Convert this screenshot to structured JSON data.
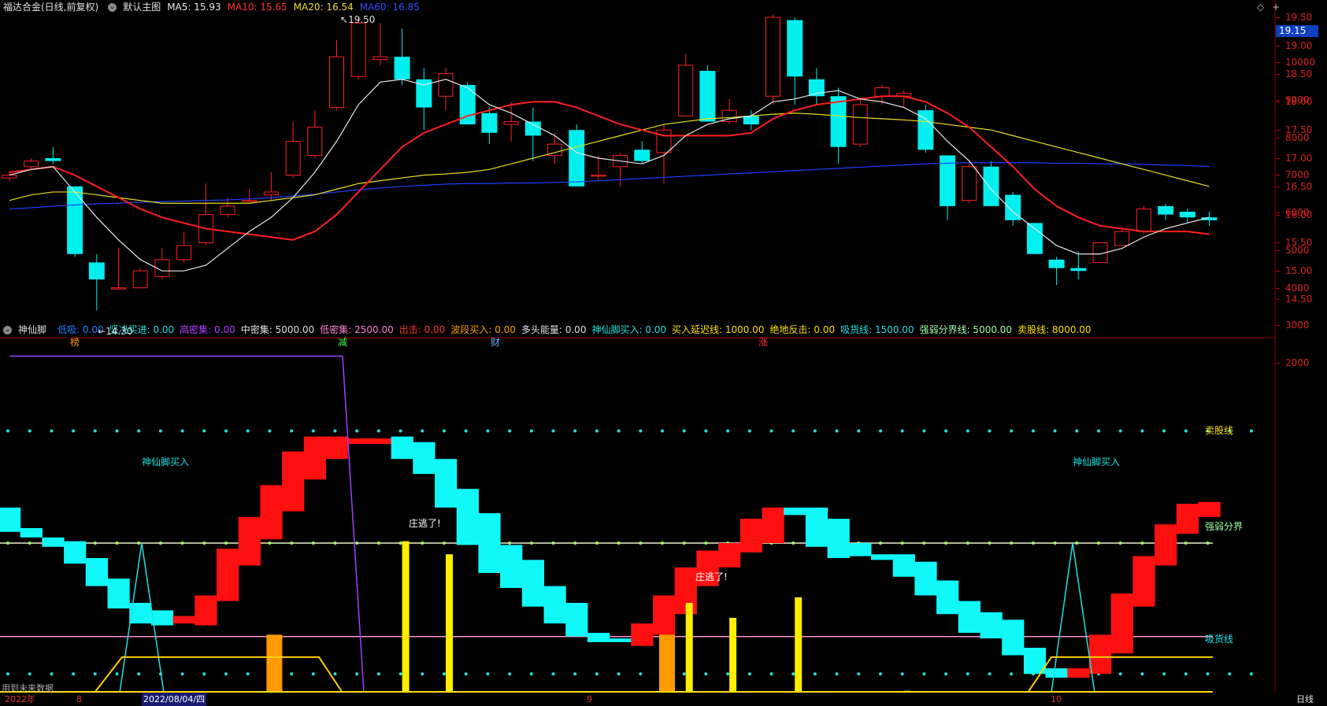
{
  "colors": {
    "up": "#ff2020",
    "down": "#00f0f0",
    "ma5": "#e8e8e8",
    "ma10": "#ff2020",
    "ma20": "#e8e020",
    "ma60": "#2040ff",
    "yellow": "#ffee00",
    "orange": "#ff9900",
    "purple": "#a040ff",
    "pink": "#ff90d0",
    "grid": "#8a0000"
  },
  "header": {
    "title": "福达合金(日线,前复权)",
    "main_chart": "默认主图",
    "ma": [
      {
        "label": "MA5: 15.93",
        "color": "#e8e8e8"
      },
      {
        "label": "MA10: 15.65",
        "color": "#ff3030"
      },
      {
        "label": "MA20: 16.54",
        "color": "#e8e020"
      },
      {
        "label": "MA60: 16.85",
        "color": "#3050ff"
      }
    ]
  },
  "indicator_header": {
    "name": "神仙脚",
    "values": [
      {
        "label": "低吸: 0.00",
        "color": "#2080ff"
      },
      {
        "label": "坚决买进: 0.00",
        "color": "#20e0e0"
      },
      {
        "label": "高密集: 0.00",
        "color": "#b040ff"
      },
      {
        "label": "中密集: 5000.00",
        "color": "#e0e0e0"
      },
      {
        "label": "低密集: 2500.00",
        "color": "#ff80d0"
      },
      {
        "label": "出击: 0.00",
        "color": "#ff3030"
      },
      {
        "label": "波段买入: 0.00",
        "color": "#ffa000"
      },
      {
        "label": "多头能量: 0.00",
        "color": "#e0e0e0"
      },
      {
        "label": "神仙脚买入: 0.00",
        "color": "#20e0e0"
      },
      {
        "label": "买入延迟线: 1000.00",
        "color": "#ffe000"
      },
      {
        "label": "绝地反击: 0.00",
        "color": "#ffe000"
      },
      {
        "label": "吸货线: 1500.00",
        "color": "#20e0e0"
      },
      {
        "label": "强弱分界线: 5000.00",
        "color": "#a0ffa0"
      },
      {
        "label": "卖股线: 8000.00",
        "color": "#ffe000"
      }
    ]
  },
  "price_axis": {
    "ticks": [
      "19.50",
      "19.00",
      "18.50",
      "18.00",
      "17.50",
      "17.00",
      "16.50",
      "16.00",
      "15.50",
      "15.00",
      "14.50"
    ],
    "current": "19.15"
  },
  "indicator_axis": {
    "ticks": [
      "10000",
      "9000",
      "8000",
      "7000",
      "6000",
      "5000",
      "4000",
      "3000",
      "2000"
    ]
  },
  "date_axis": {
    "labels": [
      "2022年",
      "8",
      "2022/08/04/四",
      "9",
      "10"
    ],
    "period": "日线"
  },
  "annotations": {
    "high": "19.50",
    "low": "14.30",
    "flags": [
      "榜",
      "减",
      "财",
      "涨"
    ]
  },
  "indicator_labels": {
    "buy1": "神仙脚买入",
    "buy2": "神仙脚买入",
    "escape1": "庄逃了!",
    "escape2": "庄逃了!",
    "sell_line": "卖股线",
    "divide_line": "强弱分界",
    "absorb_line": "吸货线",
    "footer": "用到未来数据"
  },
  "candles": [
    [
      16.65,
      16.7,
      16.6,
      16.75
    ],
    [
      16.85,
      16.95,
      16.8,
      17.0
    ],
    [
      17.0,
      16.95,
      16.9,
      17.2
    ],
    [
      16.5,
      15.3,
      15.25,
      16.5
    ],
    [
      15.15,
      14.85,
      14.3,
      15.3
    ],
    [
      14.7,
      14.7,
      14.7,
      15.4
    ],
    [
      14.7,
      15.0,
      14.7,
      15.05
    ],
    [
      14.9,
      15.2,
      14.85,
      15.4
    ],
    [
      15.2,
      15.45,
      15.15,
      15.7
    ],
    [
      15.5,
      16.0,
      15.45,
      16.55
    ],
    [
      16.0,
      16.15,
      15.95,
      16.3
    ],
    [
      16.25,
      16.25,
      16.25,
      16.45
    ],
    [
      16.35,
      16.4,
      16.25,
      16.75
    ],
    [
      16.7,
      17.3,
      16.65,
      17.65
    ],
    [
      17.05,
      17.55,
      17.0,
      17.85
    ],
    [
      17.9,
      18.8,
      17.85,
      19.1
    ],
    [
      18.45,
      19.4,
      18.4,
      19.5
    ],
    [
      18.75,
      18.8,
      18.65,
      19.4
    ],
    [
      18.8,
      18.4,
      18.3,
      19.3
    ],
    [
      18.4,
      17.9,
      17.5,
      18.6
    ],
    [
      18.1,
      18.5,
      17.85,
      18.6
    ],
    [
      18.3,
      17.6,
      17.6,
      18.35
    ],
    [
      17.8,
      17.45,
      17.25,
      17.9
    ],
    [
      17.6,
      17.65,
      17.3,
      18.0
    ],
    [
      17.65,
      17.4,
      16.95,
      17.9
    ],
    [
      17.05,
      17.25,
      16.9,
      17.45
    ],
    [
      17.5,
      16.5,
      16.5,
      17.6
    ],
    [
      16.7,
      16.7,
      16.6,
      17.05
    ],
    [
      16.85,
      17.05,
      16.5,
      17.1
    ],
    [
      17.15,
      16.95,
      16.9,
      17.3
    ],
    [
      17.1,
      17.5,
      16.55,
      17.6
    ],
    [
      17.75,
      18.65,
      17.75,
      18.85
    ],
    [
      18.55,
      17.65,
      17.65,
      18.65
    ],
    [
      17.65,
      17.85,
      17.6,
      18.05
    ],
    [
      17.75,
      17.6,
      17.5,
      17.85
    ],
    [
      18.1,
      19.5,
      17.95,
      19.55
    ],
    [
      19.45,
      18.45,
      17.95,
      19.5
    ],
    [
      18.4,
      18.1,
      17.95,
      18.6
    ],
    [
      18.1,
      17.2,
      16.9,
      18.25
    ],
    [
      17.25,
      17.95,
      17.2,
      18.05
    ],
    [
      18.1,
      18.25,
      17.95,
      18.3
    ],
    [
      18.1,
      18.15,
      17.9,
      18.2
    ],
    [
      17.85,
      17.15,
      17.1,
      17.95
    ],
    [
      17.05,
      16.15,
      15.9,
      17.05
    ],
    [
      16.25,
      16.85,
      16.2,
      16.95
    ],
    [
      16.85,
      16.15,
      16.15,
      16.95
    ],
    [
      16.35,
      15.9,
      15.8,
      16.4
    ],
    [
      15.85,
      15.3,
      15.3,
      15.85
    ],
    [
      15.2,
      15.05,
      14.75,
      15.25
    ],
    [
      15.05,
      15.0,
      14.85,
      15.35
    ],
    [
      15.15,
      15.5,
      15.15,
      15.5
    ],
    [
      15.45,
      15.7,
      15.45,
      15.75
    ],
    [
      15.7,
      16.1,
      15.65,
      16.15
    ],
    [
      16.15,
      16.0,
      15.9,
      16.2
    ],
    [
      16.05,
      15.95,
      15.85,
      16.1
    ],
    [
      15.95,
      15.9,
      15.8,
      16.05
    ]
  ],
  "ma5": [
    16.7,
    16.8,
    16.85,
    16.4,
    15.95,
    15.55,
    15.2,
    15.0,
    15.0,
    15.1,
    15.4,
    15.7,
    15.95,
    16.3,
    16.75,
    17.3,
    17.95,
    18.35,
    18.4,
    18.3,
    18.4,
    18.25,
    17.95,
    17.8,
    17.6,
    17.4,
    17.1,
    17.0,
    16.95,
    16.9,
    17.05,
    17.4,
    17.6,
    17.7,
    17.75,
    18.0,
    18.05,
    18.15,
    18.2,
    18.05,
    18.0,
    17.9,
    17.7,
    17.3,
    16.95,
    16.45,
    16.05,
    15.75,
    15.45,
    15.3,
    15.3,
    15.4,
    15.6,
    15.75,
    15.85,
    15.95
  ],
  "ma10": [
    16.75,
    16.8,
    16.85,
    16.7,
    16.5,
    16.3,
    16.1,
    15.95,
    15.85,
    15.75,
    15.7,
    15.65,
    15.6,
    15.55,
    15.7,
    16.0,
    16.4,
    16.8,
    17.2,
    17.45,
    17.6,
    17.75,
    17.85,
    17.95,
    18.0,
    18.0,
    17.9,
    17.75,
    17.6,
    17.5,
    17.4,
    17.4,
    17.4,
    17.4,
    17.45,
    17.7,
    17.85,
    17.95,
    18.0,
    18.05,
    18.1,
    18.1,
    18.0,
    17.8,
    17.55,
    17.2,
    16.85,
    16.45,
    16.15,
    15.95,
    15.8,
    15.75,
    15.7,
    15.7,
    15.7,
    15.65
  ],
  "ma20": [
    16.25,
    16.35,
    16.4,
    16.4,
    16.35,
    16.3,
    16.25,
    16.2,
    16.2,
    16.2,
    16.2,
    16.2,
    16.25,
    16.3,
    16.35,
    16.45,
    16.55,
    16.6,
    16.65,
    16.7,
    16.72,
    16.75,
    16.8,
    16.9,
    17.0,
    17.1,
    17.2,
    17.3,
    17.4,
    17.5,
    17.6,
    17.65,
    17.7,
    17.72,
    17.75,
    17.78,
    17.8,
    17.78,
    17.75,
    17.72,
    17.7,
    17.68,
    17.65,
    17.6,
    17.55,
    17.5,
    17.4,
    17.3,
    17.2,
    17.1,
    17.0,
    16.9,
    16.8,
    16.7,
    16.6,
    16.5
  ],
  "ma60": [
    16.1,
    16.12,
    16.15,
    16.17,
    16.19,
    16.2,
    16.22,
    16.23,
    16.24,
    16.25,
    16.26,
    16.28,
    16.3,
    16.33,
    16.36,
    16.4,
    16.44,
    16.47,
    16.5,
    16.52,
    16.54,
    16.55,
    16.55,
    16.56,
    16.56,
    16.57,
    16.58,
    16.6,
    16.62,
    16.64,
    16.66,
    16.68,
    16.7,
    16.72,
    16.74,
    16.76,
    16.78,
    16.8,
    16.82,
    16.84,
    16.86,
    16.88,
    16.9,
    16.91,
    16.92,
    16.92,
    16.92,
    16.92,
    16.91,
    16.91,
    16.9,
    16.9,
    16.89,
    16.88,
    16.87,
    16.85
  ],
  "strength": [
    [
      5300,
      5950,
      "c"
    ],
    [
      5150,
      5400,
      "c"
    ],
    [
      4900,
      5150,
      "c"
    ],
    [
      4450,
      5050,
      "c"
    ],
    [
      3850,
      4600,
      "c"
    ],
    [
      3250,
      4050,
      "c"
    ],
    [
      2850,
      3400,
      "c"
    ],
    [
      2800,
      3200,
      "c"
    ],
    [
      2850,
      3050,
      "r"
    ],
    [
      2800,
      3600,
      "r"
    ],
    [
      3450,
      4850,
      "r"
    ],
    [
      4400,
      5700,
      "r"
    ],
    [
      5100,
      6550,
      "r"
    ],
    [
      5850,
      7450,
      "r"
    ],
    [
      6700,
      7850,
      "r"
    ],
    [
      7250,
      7850,
      "r"
    ],
    [
      7650,
      7800,
      "r"
    ],
    [
      7650,
      7800,
      "r"
    ],
    [
      7250,
      7850,
      "c"
    ],
    [
      6850,
      7700,
      "c"
    ],
    [
      5950,
      7250,
      "c"
    ],
    [
      4950,
      6450,
      "c"
    ],
    [
      4200,
      5800,
      "c"
    ],
    [
      3800,
      4950,
      "c"
    ],
    [
      3300,
      4550,
      "c"
    ],
    [
      2850,
      3850,
      "c"
    ],
    [
      2500,
      3400,
      "c"
    ],
    [
      2350,
      2600,
      "c"
    ],
    [
      2350,
      2450,
      "c"
    ],
    [
      2250,
      2850,
      "r"
    ],
    [
      2550,
      3600,
      "r"
    ],
    [
      3100,
      4350,
      "r"
    ],
    [
      3850,
      4800,
      "r"
    ],
    [
      4350,
      5000,
      "r"
    ],
    [
      4750,
      5650,
      "r"
    ],
    [
      5000,
      5950,
      "r"
    ],
    [
      5750,
      5950,
      "c"
    ],
    [
      4900,
      5950,
      "c"
    ],
    [
      4600,
      5650,
      "c"
    ],
    [
      4650,
      5000,
      "c"
    ],
    [
      4550,
      4700,
      "c"
    ],
    [
      4100,
      4700,
      "c"
    ],
    [
      3600,
      4500,
      "c"
    ],
    [
      3100,
      4000,
      "c"
    ],
    [
      2600,
      3450,
      "c"
    ],
    [
      2450,
      3150,
      "c"
    ],
    [
      2000,
      2950,
      "c"
    ],
    [
      1500,
      2200,
      "c"
    ],
    [
      1400,
      1650,
      "c"
    ],
    [
      1400,
      1650,
      "r"
    ],
    [
      1500,
      2550,
      "r"
    ],
    [
      2050,
      3650,
      "r"
    ],
    [
      3300,
      4650,
      "r"
    ],
    [
      4400,
      5500,
      "r"
    ],
    [
      5250,
      6050,
      "r"
    ],
    [
      5700,
      6100,
      "r"
    ]
  ],
  "yellow_bars": [
    [
      18,
      5050
    ],
    [
      20,
      4700
    ],
    [
      31,
      3400
    ],
    [
      33,
      3000
    ],
    [
      36,
      3550
    ],
    [
      41,
      1050
    ]
  ],
  "orange_bars": [
    [
      12,
      2550
    ],
    [
      30,
      2550
    ]
  ]
}
